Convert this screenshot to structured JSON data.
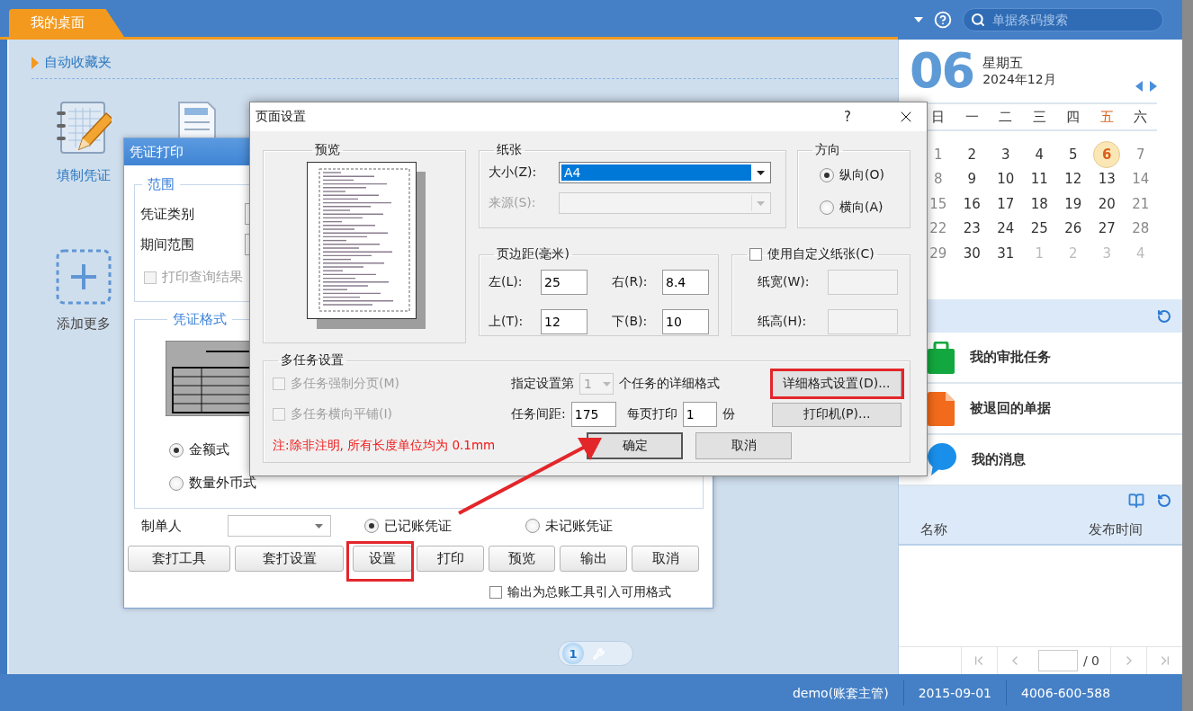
{
  "top_bar": {
    "tab": "我的桌面",
    "search": {
      "placeholder": "单据条码搜索"
    }
  },
  "favorites": {
    "title": "自动收藏夹",
    "items": [
      {
        "kind": "voucher",
        "label": "填制凭证"
      },
      {
        "kind": "document"
      },
      {
        "kind": "add",
        "label": "添加更多"
      }
    ]
  },
  "desktop_pager": {
    "page": "1"
  },
  "voucher_print": {
    "title": "凭证打印",
    "range": {
      "title": "范围",
      "fields": [
        "凭证类别",
        "期间范围"
      ],
      "print_result": {
        "label": "打印查询结果",
        "checked": false,
        "disabled": true
      }
    },
    "format": {
      "title": "凭证格式",
      "options": [
        {
          "label": "金额式",
          "selected": true
        },
        {
          "label": "数量外币式",
          "selected": false
        }
      ]
    },
    "maker": {
      "label": "制单人"
    },
    "posted": [
      {
        "label": "已记账凭证",
        "selected": true
      },
      {
        "label": "未记账凭证",
        "selected": false
      }
    ],
    "buttons": [
      {
        "label": "套打工具",
        "highlighted": false
      },
      {
        "label": "套打设置",
        "highlighted": false
      },
      {
        "label": "设置",
        "highlighted": true
      },
      {
        "label": "打印",
        "highlighted": false
      },
      {
        "label": "预览",
        "highlighted": false
      },
      {
        "label": "输出",
        "highlighted": false
      },
      {
        "label": "取消",
        "highlighted": false
      }
    ],
    "export": {
      "label": "输出为总账工具引入可用格式",
      "checked": false
    }
  },
  "page_setup": {
    "title": "页面设置",
    "help": "?",
    "preview": {
      "title": "预览"
    },
    "paper": {
      "title": "纸张",
      "size": {
        "label": "大小(Z):",
        "value": "A4"
      },
      "source": {
        "label": "来源(S):",
        "disabled": true
      }
    },
    "orientation": {
      "title": "方向",
      "options": [
        {
          "label": "纵向(O)",
          "selected": true
        },
        {
          "label": "横向(A)",
          "selected": false
        }
      ]
    },
    "margins": {
      "title": "页边距(毫米)",
      "fields": [
        {
          "label": "左(L):",
          "value": "25"
        },
        {
          "label": "右(R):",
          "value": "8.4"
        },
        {
          "label": "上(T):",
          "value": "12"
        },
        {
          "label": "下(B):",
          "value": "10"
        }
      ]
    },
    "custom_paper": {
      "label": "使用自定义纸张(C)",
      "checked": false,
      "fields": [
        "纸宽(W):",
        "纸高(H):"
      ]
    },
    "multi_task": {
      "title": "多任务设置",
      "options": [
        {
          "label": "多任务强制分页(M)",
          "checked": false,
          "disabled": true
        },
        {
          "label": "多任务横向平铺(I)",
          "checked": false,
          "disabled": true
        }
      ],
      "task_index": {
        "prefix": "指定设置第",
        "value": "1",
        "suffix": "个任务的详细格式"
      },
      "spacing": {
        "label": "任务间距:",
        "value": "175"
      },
      "per_page": {
        "label": "每页打印",
        "value": "1",
        "unit": "份"
      },
      "note": "注:除非注明, 所有长度单位均为 0.1mm",
      "buttons": [
        {
          "label": "详细格式设置(D)...",
          "highlighted": true
        },
        {
          "label": "打印机(P)...",
          "highlighted": false
        }
      ]
    },
    "footer": [
      {
        "label": "确定",
        "default": true
      },
      {
        "label": "取消",
        "default": false
      }
    ]
  },
  "calendar": {
    "day": "06",
    "weekday": "星期五",
    "month": "2024年12月",
    "weekdays": [
      {
        "label": "日",
        "selected": false
      },
      {
        "label": "一",
        "selected": false
      },
      {
        "label": "二",
        "selected": false
      },
      {
        "label": "三",
        "selected": false
      },
      {
        "label": "四",
        "selected": false
      },
      {
        "label": "五",
        "selected": true
      },
      {
        "label": "六",
        "selected": false
      }
    ],
    "weeks": [
      [
        {
          "day": "1",
          "kind": "weekend"
        },
        {
          "day": "2",
          "kind": "weekday"
        },
        {
          "day": "3",
          "kind": "weekday"
        },
        {
          "day": "4",
          "kind": "weekday"
        },
        {
          "day": "5",
          "kind": "weekday"
        },
        {
          "day": "6",
          "kind": "today"
        },
        {
          "day": "7",
          "kind": "weekend"
        }
      ],
      [
        {
          "day": "8",
          "kind": "weekend"
        },
        {
          "day": "9",
          "kind": "weekday"
        },
        {
          "day": "10",
          "kind": "weekday"
        },
        {
          "day": "11",
          "kind": "weekday"
        },
        {
          "day": "12",
          "kind": "weekday"
        },
        {
          "day": "13",
          "kind": "weekday"
        },
        {
          "day": "14",
          "kind": "weekend"
        }
      ],
      [
        {
          "day": "15",
          "kind": "weekend"
        },
        {
          "day": "16",
          "kind": "weekday"
        },
        {
          "day": "17",
          "kind": "weekday"
        },
        {
          "day": "18",
          "kind": "weekday"
        },
        {
          "day": "19",
          "kind": "weekday"
        },
        {
          "day": "20",
          "kind": "weekday"
        },
        {
          "day": "21",
          "kind": "weekend"
        }
      ],
      [
        {
          "day": "22",
          "kind": "weekend"
        },
        {
          "day": "23",
          "kind": "weekday"
        },
        {
          "day": "24",
          "kind": "weekday"
        },
        {
          "day": "25",
          "kind": "weekday"
        },
        {
          "day": "26",
          "kind": "weekday"
        },
        {
          "day": "27",
          "kind": "weekday"
        },
        {
          "day": "28",
          "kind": "weekend"
        }
      ],
      [
        {
          "day": "29",
          "kind": "weekend"
        },
        {
          "day": "30",
          "kind": "weekday"
        },
        {
          "day": "31",
          "kind": "weekday"
        },
        {
          "day": "1",
          "kind": "other"
        },
        {
          "day": "2",
          "kind": "other"
        },
        {
          "day": "3",
          "kind": "other"
        },
        {
          "day": "4",
          "kind": "other"
        }
      ]
    ]
  },
  "tasks": [
    {
      "kind": "approval",
      "label": "我的审批任务"
    },
    {
      "kind": "returned",
      "label": "被退回的单据"
    },
    {
      "kind": "message",
      "label": "我的消息"
    }
  ],
  "notices": {
    "columns": [
      "名称",
      "发布时间"
    ],
    "pager": {
      "total": "/ 0"
    }
  },
  "status_bar": [
    "demo(账套主管)",
    "2015-09-01",
    "4006-600-588"
  ]
}
